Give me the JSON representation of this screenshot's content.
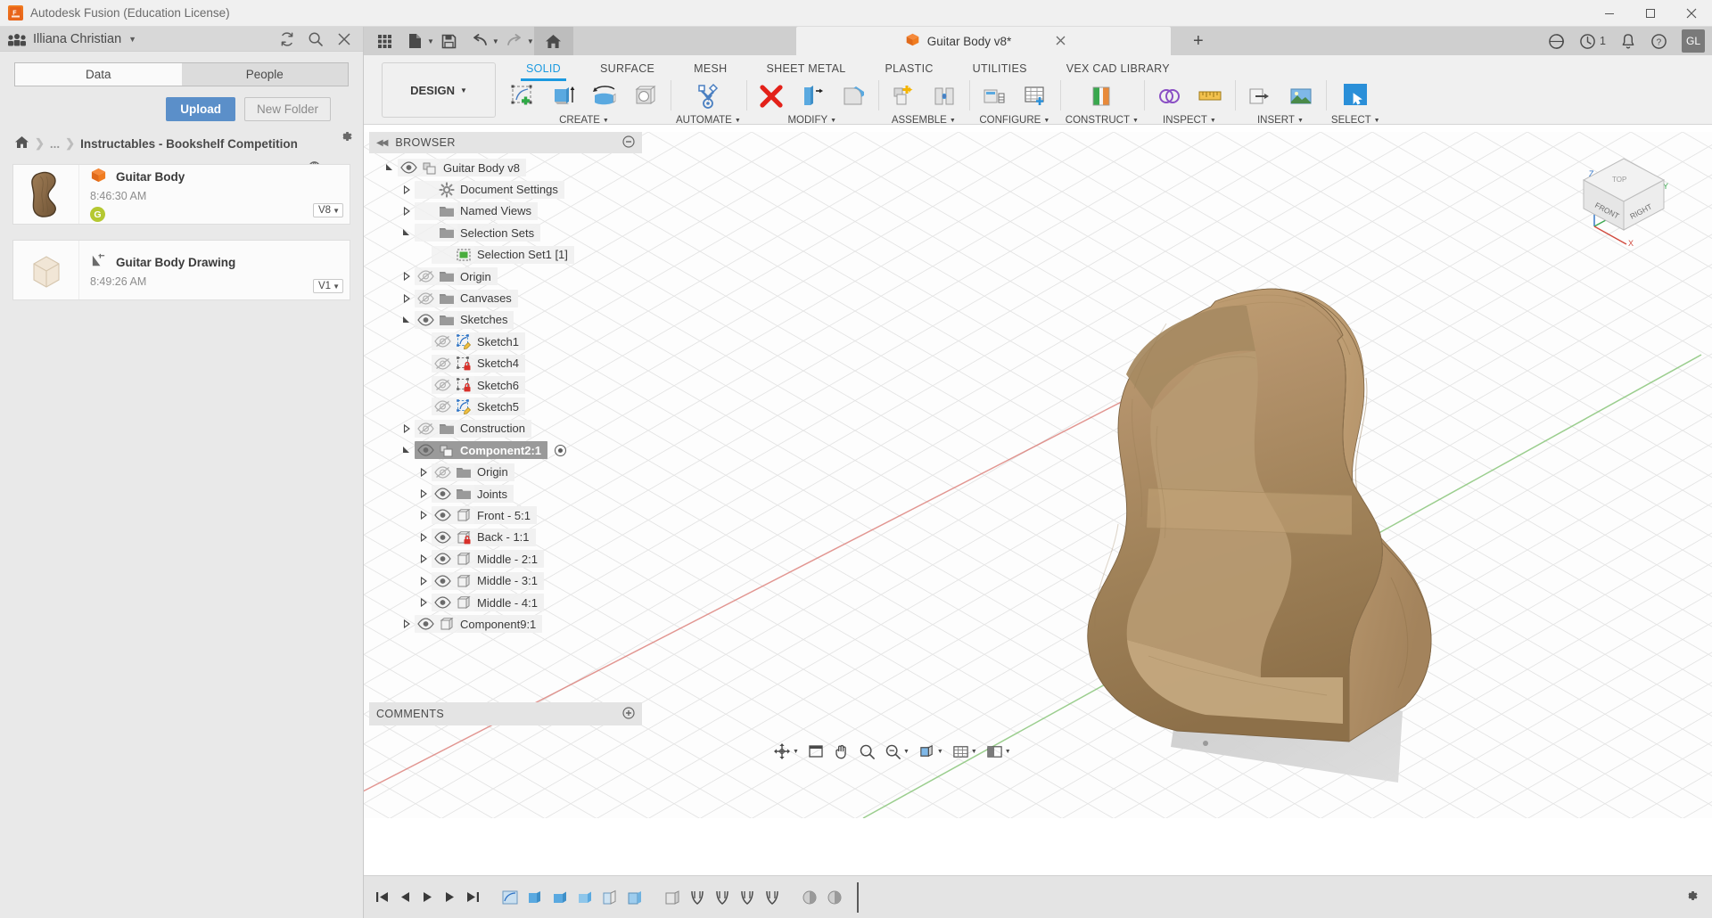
{
  "window": {
    "title": "Autodesk Fusion (Education License)",
    "logo_text": "F",
    "minimize": "minimize-icon",
    "maximize": "maximize-icon",
    "close": "close-icon"
  },
  "data_panel": {
    "user_name": "Illiana Christian",
    "header_icons": [
      "refresh-icon",
      "search-icon",
      "close-icon"
    ],
    "tabs": [
      {
        "label": "Data",
        "active": true
      },
      {
        "label": "People",
        "active": false
      }
    ],
    "upload_label": "Upload",
    "new_folder_label": "New Folder",
    "breadcrumb": {
      "home": "home-icon",
      "ellipsis": "...",
      "current": "Instructables - Bookshelf Competition"
    },
    "files": [
      {
        "name": "Guitar Body",
        "time": "8:46:30 AM",
        "badge": "G",
        "version": "V8",
        "type": "design"
      },
      {
        "name": "Guitar Body Drawing",
        "time": "8:49:26 AM",
        "badge": "",
        "version": "V1",
        "type": "drawing"
      }
    ]
  },
  "quick_access": {
    "buttons": [
      "grid-apps-icon",
      "new-file-icon",
      "save-icon",
      "undo-icon",
      "redo-icon",
      "home-icon"
    ],
    "document_tab": {
      "label": "Guitar Body v8*",
      "close": "close-icon"
    },
    "add_tab": "+",
    "right_icons": [
      "help-circle-icon",
      "job-status-icon",
      "notification-bell-icon",
      "question-help-icon"
    ],
    "job_count": "1",
    "avatar_initials": "GL"
  },
  "ribbon": {
    "workspace": "DESIGN",
    "tabs": [
      {
        "label": "SOLID",
        "active": true
      },
      {
        "label": "SURFACE",
        "active": false
      },
      {
        "label": "MESH",
        "active": false
      },
      {
        "label": "SHEET METAL",
        "active": false
      },
      {
        "label": "PLASTIC",
        "active": false
      },
      {
        "label": "UTILITIES",
        "active": false
      },
      {
        "label": "VEX CAD LIBRARY",
        "active": false
      }
    ],
    "panels": [
      {
        "label": "CREATE",
        "dropdown": true,
        "tools": [
          "create-sketch-icon",
          "extrude-icon",
          "revolve-icon",
          "hole-icon"
        ]
      },
      {
        "label": "AUTOMATE",
        "dropdown": true,
        "tools": [
          "automate-icon"
        ]
      },
      {
        "label": "MODIFY",
        "dropdown": true,
        "tools": [
          "delete-icon",
          "press-pull-icon",
          "fillet-icon"
        ]
      },
      {
        "label": "ASSEMBLE",
        "dropdown": true,
        "tools": [
          "new-component-icon",
          "joint-icon"
        ]
      },
      {
        "label": "CONFIGURE",
        "dropdown": true,
        "tools": [
          "configure-icon",
          "config-table-icon"
        ]
      },
      {
        "label": "CONSTRUCT",
        "dropdown": true,
        "tools": [
          "offset-plane-icon"
        ]
      },
      {
        "label": "INSPECT",
        "dropdown": true,
        "tools": [
          "interference-icon",
          "measure-icon"
        ]
      },
      {
        "label": "INSERT",
        "dropdown": true,
        "tools": [
          "insert-derive-icon",
          "insert-image-icon"
        ]
      },
      {
        "label": "SELECT",
        "dropdown": true,
        "tools": [
          "select-icon"
        ]
      }
    ]
  },
  "browser": {
    "title": "BROWSER",
    "collapse": "collapse-icon",
    "minimize": "minimize-icon",
    "tree": [
      {
        "label": "Guitar Body v8",
        "indent": 0,
        "arrow": "open",
        "eye": "visible",
        "icon": "document-icon",
        "selected": false
      },
      {
        "label": "Document Settings",
        "indent": 1,
        "arrow": "closed",
        "eye": "none",
        "icon": "gear-icon",
        "selected": false
      },
      {
        "label": "Named Views",
        "indent": 1,
        "arrow": "closed",
        "eye": "none",
        "icon": "folder-icon",
        "selected": false
      },
      {
        "label": "Selection Sets",
        "indent": 1,
        "arrow": "open",
        "eye": "none",
        "icon": "folder-icon",
        "selected": false
      },
      {
        "label": "Selection Set1 [1]",
        "indent": 2,
        "arrow": "none",
        "eye": "none",
        "icon": "selection-set-icon",
        "selected": false
      },
      {
        "label": "Origin",
        "indent": 1,
        "arrow": "closed",
        "eye": "hidden",
        "icon": "folder-icon",
        "selected": false
      },
      {
        "label": "Canvases",
        "indent": 1,
        "arrow": "closed",
        "eye": "hidden",
        "icon": "folder-icon",
        "selected": false
      },
      {
        "label": "Sketches",
        "indent": 1,
        "arrow": "open",
        "eye": "visible",
        "icon": "folder-icon",
        "selected": false
      },
      {
        "label": "Sketch1",
        "indent": 2,
        "arrow": "none",
        "eye": "hidden",
        "icon": "sketch-edit-icon",
        "selected": false
      },
      {
        "label": "Sketch4",
        "indent": 2,
        "arrow": "none",
        "eye": "hidden",
        "icon": "sketch-locked-icon",
        "selected": false
      },
      {
        "label": "Sketch6",
        "indent": 2,
        "arrow": "none",
        "eye": "hidden",
        "icon": "sketch-locked-icon",
        "selected": false
      },
      {
        "label": "Sketch5",
        "indent": 2,
        "arrow": "none",
        "eye": "hidden",
        "icon": "sketch-edit-icon",
        "selected": false
      },
      {
        "label": "Construction",
        "indent": 1,
        "arrow": "closed",
        "eye": "hidden",
        "icon": "folder-icon",
        "selected": false
      },
      {
        "label": "Component2:1",
        "indent": 1,
        "arrow": "open",
        "eye": "visible",
        "icon": "component-icon",
        "selected": true
      },
      {
        "label": "Origin",
        "indent": 2,
        "arrow": "closed",
        "eye": "hidden",
        "icon": "folder-icon",
        "selected": false
      },
      {
        "label": "Joints",
        "indent": 2,
        "arrow": "closed",
        "eye": "visible",
        "icon": "folder-icon",
        "selected": false
      },
      {
        "label": "Front - 5:1",
        "indent": 2,
        "arrow": "closed",
        "eye": "visible",
        "icon": "body-icon",
        "selected": false
      },
      {
        "label": "Back - 1:1",
        "indent": 2,
        "arrow": "closed",
        "eye": "visible",
        "icon": "body-locked-icon",
        "selected": false
      },
      {
        "label": "Middle - 2:1",
        "indent": 2,
        "arrow": "closed",
        "eye": "visible",
        "icon": "body-icon",
        "selected": false
      },
      {
        "label": "Middle - 3:1",
        "indent": 2,
        "arrow": "closed",
        "eye": "visible",
        "icon": "body-icon",
        "selected": false
      },
      {
        "label": "Middle - 4:1",
        "indent": 2,
        "arrow": "closed",
        "eye": "visible",
        "icon": "body-icon",
        "selected": false
      },
      {
        "label": "Component9:1",
        "indent": 1,
        "arrow": "closed",
        "eye": "visible",
        "icon": "body-icon",
        "selected": false
      }
    ]
  },
  "comments": {
    "title": "COMMENTS",
    "add": "add-comment-icon"
  },
  "viewcube": {
    "front": "FRONT",
    "right": "RIGHT",
    "top": "TOP",
    "axis_x": "X",
    "axis_y": "Y",
    "axis_z": "Z"
  },
  "nav_bar": {
    "items": [
      "orbit-icon",
      "lock-grid-icon",
      "pan-icon",
      "zoom-icon",
      "zoom-fit-icon",
      "display-settings-icon",
      "grid-snap-icon",
      "viewports-icon"
    ]
  },
  "timeline": {
    "playback": [
      "skip-start-icon",
      "step-back-icon",
      "play-icon",
      "step-forward-icon",
      "skip-end-icon"
    ],
    "features": [
      "sketch-feature",
      "extrude-feature",
      "extrude-feature",
      "extrude-feature",
      "extrude-feature",
      "extrude-feature",
      "extrude-feature",
      "joint-feature",
      "joint-feature",
      "joint-feature",
      "joint-feature",
      "appearance-feature",
      "appearance-feature"
    ],
    "settings": "gear-icon"
  },
  "colors": {
    "accent": "#1b9ae0",
    "upload_button": "#5b8fc9",
    "badge_green": "#b5c832",
    "brand_orange": "#e8641a",
    "selection_gray": "#9a9a9a",
    "wood": "#b08a5e"
  }
}
